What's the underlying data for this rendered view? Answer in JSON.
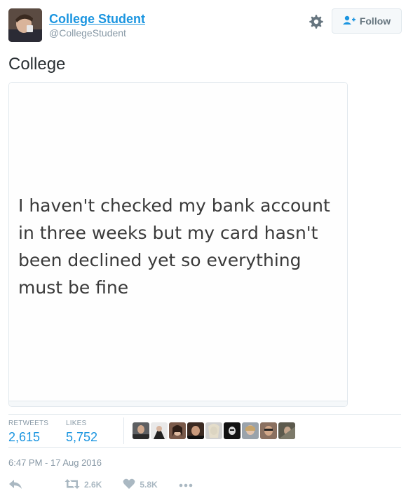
{
  "header": {
    "display_name": "College Student",
    "handle": "@CollegeStudent",
    "follow_label": "Follow"
  },
  "tweet": {
    "text": "College",
    "image_text": "I haven't checked my bank account in three weeks but my card hasn't been declined yet so everything must be fine"
  },
  "stats": {
    "retweets_label": "RETWEETS",
    "retweets_value": "2,615",
    "likes_label": "LIKES",
    "likes_value": "5,752",
    "liker_count": 9
  },
  "timestamp": "6:47 PM - 17 Aug 2016",
  "actions": {
    "retweet_count": "2.6K",
    "like_count": "5.8K"
  },
  "icons": {
    "settings": "gear-icon",
    "follow": "add-user-icon",
    "reply": "reply-icon",
    "retweet": "retweet-icon",
    "like": "heart-icon",
    "more": "more-icon"
  },
  "colors": {
    "link": "#1b95e0",
    "muted": "#8899a6",
    "action": "#aab8c2",
    "border": "#e1e8ed"
  }
}
